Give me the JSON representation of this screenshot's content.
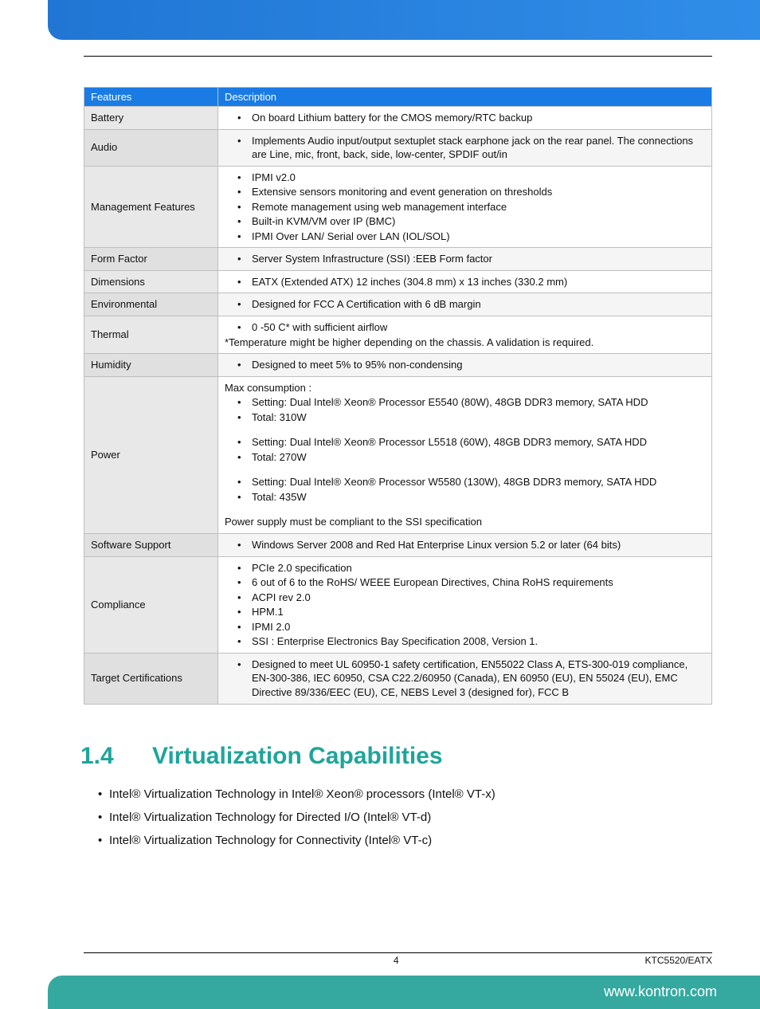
{
  "table": {
    "headers": [
      "Features",
      "Description"
    ],
    "rows": [
      {
        "feature": "Battery",
        "alt": false,
        "content": {
          "type": "bullets",
          "items": [
            "On board Lithium battery for the CMOS memory/RTC backup"
          ]
        }
      },
      {
        "feature": "Audio",
        "alt": true,
        "content": {
          "type": "bullets",
          "items": [
            "Implements Audio input/output sextuplet stack earphone jack on the rear panel. The connections are Line, mic, front, back, side, low-center, SPDIF out/in"
          ]
        }
      },
      {
        "feature": "Management Features",
        "alt": false,
        "content": {
          "type": "bullets",
          "items": [
            "IPMI v2.0",
            "Extensive sensors monitoring and event generation on thresholds",
            "Remote management using web management interface",
            "Built-in KVM/VM over IP (BMC)",
            "IPMI Over LAN/ Serial over LAN (IOL/SOL)"
          ]
        }
      },
      {
        "feature": "Form Factor",
        "alt": true,
        "content": {
          "type": "bullets",
          "items": [
            "Server System Infrastructure (SSI) :EEB Form factor"
          ]
        }
      },
      {
        "feature": "Dimensions",
        "alt": false,
        "content": {
          "type": "bullets",
          "items": [
            "EATX (Extended ATX) 12 inches (304.8 mm)  x 13 inches (330.2 mm)"
          ]
        }
      },
      {
        "feature": "Environmental",
        "alt": true,
        "content": {
          "type": "bullets",
          "items": [
            "Designed for FCC A Certification with 6 dB margin"
          ]
        }
      },
      {
        "feature": "Thermal",
        "alt": false,
        "content": {
          "type": "mixed",
          "lines": [
            {
              "kind": "bullet",
              "text": "0 -50 C* with sufficient airflow"
            },
            {
              "kind": "plain",
              "text": "*Temperature might be higher depending on the chassis. A validation is required."
            }
          ]
        }
      },
      {
        "feature": "Humidity",
        "alt": true,
        "content": {
          "type": "bullets",
          "items": [
            "Designed to meet 5% to 95% non-condensing"
          ]
        }
      },
      {
        "feature": "Power",
        "alt": false,
        "content": {
          "type": "mixed",
          "lines": [
            {
              "kind": "plain",
              "text": "Max consumption :"
            },
            {
              "kind": "bullet",
              "text": "Setting: Dual Intel® Xeon® Processor E5540 (80W), 48GB DDR3 memory, SATA HDD"
            },
            {
              "kind": "bullet",
              "text": "Total: 310W"
            },
            {
              "kind": "blank"
            },
            {
              "kind": "bullet",
              "text": "Setting: Dual Intel® Xeon® Processor L5518 (60W), 48GB DDR3 memory, SATA HDD"
            },
            {
              "kind": "bullet",
              "text": "Total: 270W"
            },
            {
              "kind": "blank"
            },
            {
              "kind": "bullet",
              "text": "Setting: Dual Intel® Xeon® Processor W5580 (130W), 48GB DDR3 memory, SATA HDD"
            },
            {
              "kind": "bullet",
              "text": "Total: 435W"
            },
            {
              "kind": "blank"
            },
            {
              "kind": "plain",
              "text": "Power supply must be compliant to the SSI specification"
            }
          ]
        }
      },
      {
        "feature": "Software Support",
        "alt": true,
        "content": {
          "type": "bullets",
          "items": [
            "Windows Server 2008 and Red Hat Enterprise Linux version 5.2 or later (64 bits)"
          ]
        }
      },
      {
        "feature": "Compliance",
        "alt": false,
        "content": {
          "type": "bullets",
          "items": [
            "PCIe 2.0 specification",
            "6 out of 6 to the RoHS/ WEEE European Directives, China RoHS requirements",
            "ACPI rev 2.0",
            "HPM.1",
            "IPMI 2.0",
            "SSI : Enterprise Electronics Bay Specification 2008, Version 1."
          ]
        }
      },
      {
        "feature": "Target Certifications",
        "alt": true,
        "content": {
          "type": "bullets",
          "items": [
            "Designed to meet UL 60950-1 safety certification, EN55022 Class A, ETS-300-019 compliance, EN-300-386, IEC 60950, CSA C22.2/60950 (Canada), EN 60950 (EU), EN 55024 (EU), EMC Directive 89/336/EEC (EU), CE, NEBS Level 3 (designed for), FCC B"
          ]
        }
      }
    ]
  },
  "section": {
    "number": "1.4",
    "title": "Virtualization Capabilities",
    "bullets": [
      "Intel® Virtualization Technology in Intel® Xeon® processors (Intel® VT-x)",
      "Intel® Virtualization Technology for Directed I/O  (Intel® VT-d)",
      "Intel® Virtualization Technology for Connectivity (Intel® VT-c)"
    ]
  },
  "footer": {
    "page_number": "4",
    "doc_id": "KTC5520/EATX",
    "url": "www.kontron.com"
  }
}
